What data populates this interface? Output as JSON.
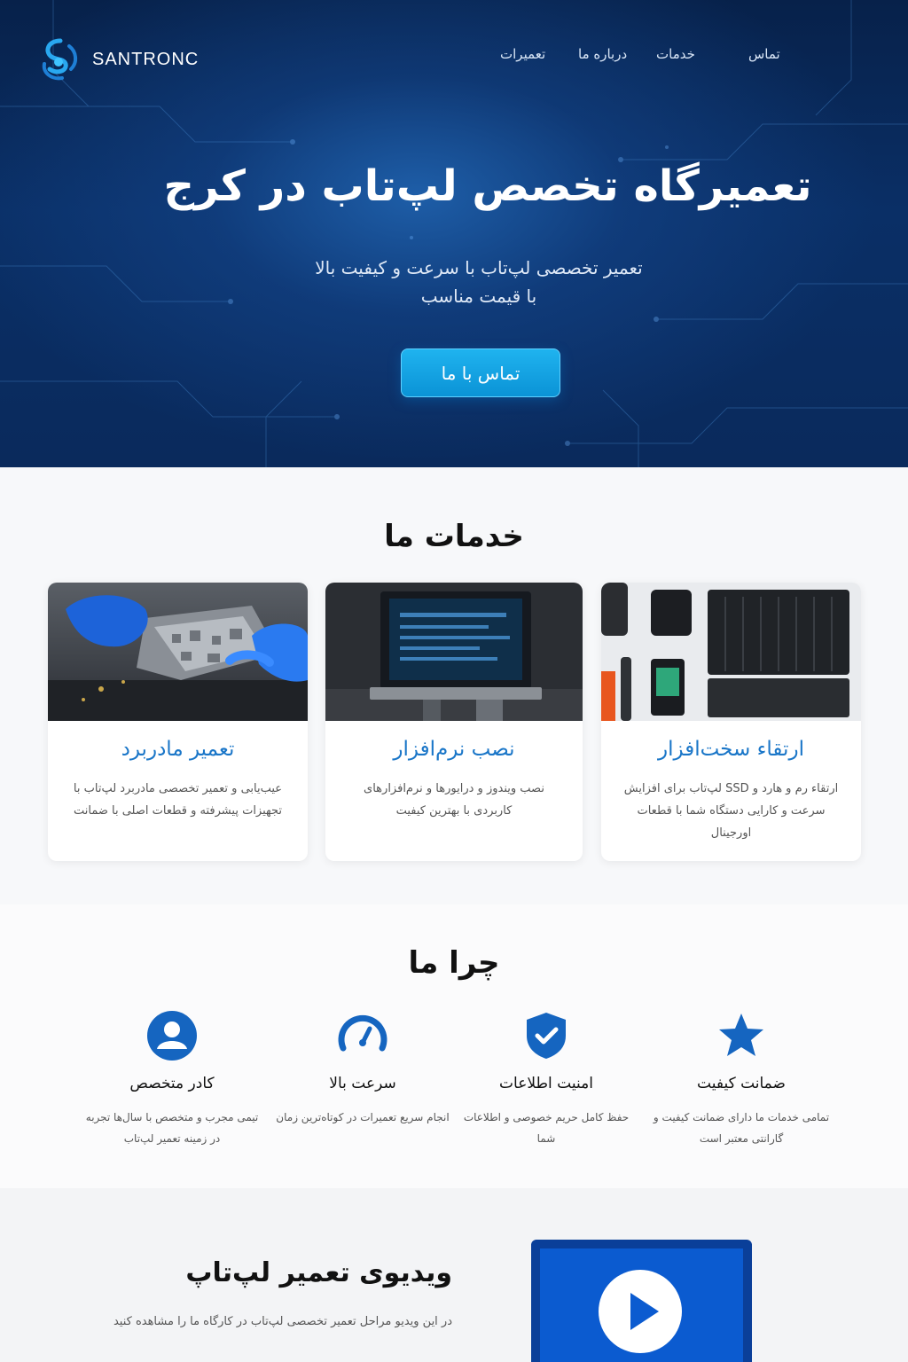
{
  "header": {
    "brand": "SANTRONC",
    "nav": [
      "تماس",
      "خدمات",
      "درباره ما",
      "تعمیرات"
    ]
  },
  "hero": {
    "title": "تعمیرگاه تخصص لپ‌تاب در کرج",
    "subtitle_line1": "تعمیر تخصصی لپ‌تاب با سرعت و کیفیت بالا",
    "subtitle_line2": "با قیمت مناسب",
    "cta": "تماس با ما"
  },
  "services": {
    "title": "خدمات ما",
    "cards": [
      {
        "title": "تعمیر مادربرد",
        "desc": "عیب‌یابی و تعمیر تخصصی مادربرد لپ‌تاب با تجهیزات پیشرفته و قطعات اصلی با ضمانت"
      },
      {
        "title": "نصب نرم‌افزار",
        "desc": "نصب ویندوز و درایورها و نرم‌افزارهای کاربردی با بهترین کیفیت"
      },
      {
        "title": "ارتقاء سخت‌افزار",
        "desc": "ارتقاء رم و هارد و SSD لپ‌تاب برای افزایش سرعت و کارایی دستگاه شما با قطعات اورجینال"
      }
    ]
  },
  "why": {
    "title": "چرا ما",
    "features": [
      {
        "icon": "star-icon",
        "title": "ضمانت کیفیت",
        "desc": "تمامی خدمات ما دارای ضمانت کیفیت و گارانتی معتبر است"
      },
      {
        "icon": "shield-check-icon",
        "title": "امنیت اطلاعات",
        "desc": "حفظ کامل حریم خصوصی و اطلاعات شما"
      },
      {
        "icon": "speedometer-icon",
        "title": "سرعت بالا",
        "desc": "انجام سریع تعمیرات در کوتاه‌ترین زمان"
      },
      {
        "icon": "user-icon",
        "title": "کادر متخصص",
        "desc": "تیمی مجرب و متخصص با سال‌ها تجربه در زمینه تعمیر لپ‌تاب"
      }
    ]
  },
  "video": {
    "title": "ویدیوی تعمیر لپ‌تاپ",
    "desc": "در این ویدیو مراحل تعمیر تخصصی لپ‌تاب در کارگاه ما را مشاهده کنید"
  },
  "colors": {
    "hero_bg": "#0a2f66",
    "accent": "#1a76c8",
    "cta": "#1fb3ef",
    "icon": "#1565c0"
  }
}
